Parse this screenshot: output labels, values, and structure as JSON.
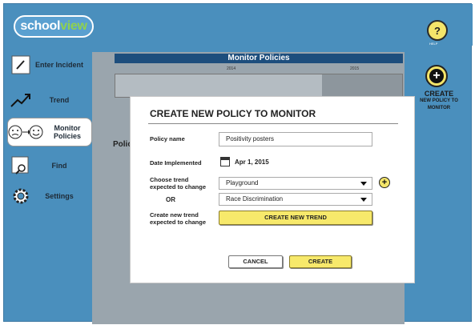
{
  "app": {
    "logo_school": "school",
    "logo_view": "view",
    "help_label": "?",
    "help_caption": "HELP"
  },
  "sidebar": {
    "items": [
      {
        "label": "Enter Incident",
        "icon": "pencil-icon"
      },
      {
        "label": "Trend",
        "icon": "trend-icon"
      },
      {
        "label": "Monitor Policies",
        "icon": "face-icon"
      },
      {
        "label": "Find",
        "icon": "search-icon"
      },
      {
        "label": "Settings",
        "icon": "gear-icon"
      }
    ]
  },
  "main": {
    "header": "Monitor Policies",
    "year_left": "2014",
    "year_right": "2015",
    "policy_label": "Policy"
  },
  "right": {
    "create_label": "CREATE",
    "create_sub": "NEW POLICY TO MONITOR"
  },
  "modal": {
    "title": "CREATE NEW POLICY TO MONITOR",
    "policy_name_label": "Policy name",
    "policy_name_value": "Positivity posters",
    "date_label": "Date Implemented",
    "date_value": "Apr 1, 2015",
    "trend_label": "Choose trend expected to change",
    "trend_value": "Playground",
    "or_label": "OR",
    "trend2_value": "Race Discrimination",
    "create_trend_label": "Create new trend expected to change",
    "create_trend_button": "CREATE NEW TREND",
    "cancel_button": "CANCEL",
    "create_button": "CREATE"
  },
  "colors": {
    "background": "#4a8fbd",
    "accent_yellow": "#f7e96b",
    "header_blue": "#1d4e7d"
  }
}
